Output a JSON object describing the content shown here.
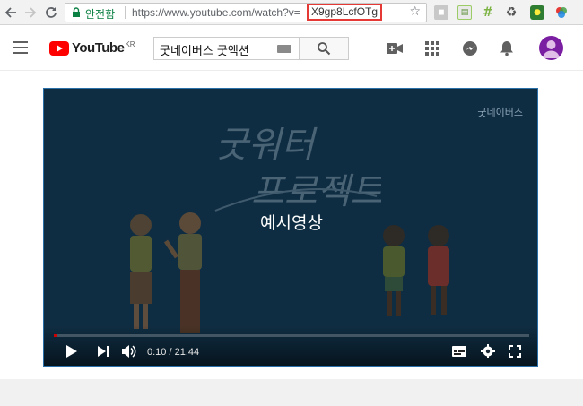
{
  "browser": {
    "secure_label": "안전함",
    "url_prefix": "https://www.youtube.com/watch?v=",
    "url_video_id": "X9gp8LcfOTg",
    "extension_icons": [
      "extension-grey-icon",
      "extension-document-icon",
      "ladder-icon",
      "recycle-icon",
      "extension-green-icon",
      "color-circles-icon"
    ]
  },
  "header": {
    "logo_text": "YouTube",
    "logo_region": "KR",
    "search_value": "굿네이버스 굿액션",
    "icons": [
      "menu-icon",
      "upload-camera-icon",
      "apps-grid-icon",
      "share-icon",
      "bell-icon",
      "avatar"
    ]
  },
  "player": {
    "brand": "굿네이버스",
    "title_art": [
      "굿워터",
      "프로젝트"
    ],
    "caption": "예시영상",
    "time_display": "0:10 / 21:44",
    "progress_fraction": 0.008,
    "colors": {
      "background": "#0f2d42",
      "accent": "#cc0000"
    }
  }
}
